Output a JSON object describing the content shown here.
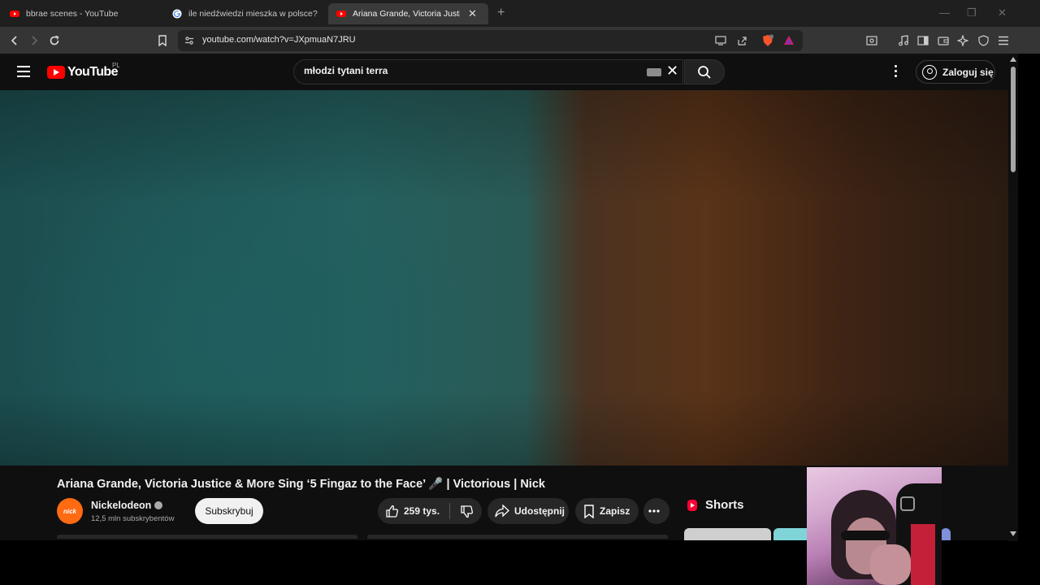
{
  "browser": {
    "tabs": [
      {
        "title": "bbrae scenes - YouTube",
        "active": false
      },
      {
        "title": "ile niedźwiedzi mieszka w polsce? - S",
        "active": false
      },
      {
        "title": "Ariana Grande, Victoria Justice &",
        "active": true
      }
    ],
    "new_tab": "+",
    "url": "youtube.com/watch?v=JXpmuaN7JRU"
  },
  "youtube": {
    "logo_text": "YouTube",
    "country_code": "PL",
    "search": {
      "value": "młodzi tytani terra"
    },
    "signin_label": "Zaloguj się"
  },
  "video": {
    "title": "Ariana Grande, Victoria Justice & More Sing ‘5 Fingaz to the Face’ 🎤 | Victorious | Nick",
    "channel": {
      "name": "Nickelodeon",
      "subscribers": "12,5 mln subskrybentów",
      "avatar_text": "nick"
    },
    "subscribe_label": "Subskrybuj",
    "likes": "259 tys.",
    "share_label": "Udostępnij",
    "save_label": "Zapisz"
  },
  "sidebar": {
    "shorts_label": "Shorts"
  },
  "colors": {
    "youtube_red": "#ff0000",
    "background": "#0f0f0f",
    "channel_orange": "#ff6a13"
  }
}
